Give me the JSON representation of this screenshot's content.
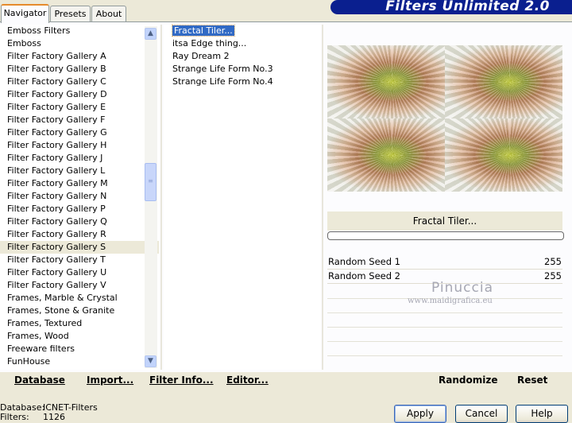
{
  "tabs": [
    "Navigator",
    "Presets",
    "About"
  ],
  "banner_title": "Filters Unlimited 2.0",
  "categories": [
    "Emboss Filters",
    "Emboss",
    "Filter Factory Gallery A",
    "Filter Factory Gallery B",
    "Filter Factory Gallery C",
    "Filter Factory Gallery D",
    "Filter Factory Gallery E",
    "Filter Factory Gallery F",
    "Filter Factory Gallery G",
    "Filter Factory Gallery H",
    "Filter Factory Gallery J",
    "Filter Factory Gallery L",
    "Filter Factory Gallery M",
    "Filter Factory Gallery N",
    "Filter Factory Gallery P",
    "Filter Factory Gallery Q",
    "Filter Factory Gallery R",
    "Filter Factory Gallery S",
    "Filter Factory Gallery T",
    "Filter Factory Gallery U",
    "Filter Factory Gallery V",
    "Frames, Marble & Crystal",
    "Frames, Stone & Granite",
    "Frames, Textured",
    "Frames, Wood",
    "Freeware filters",
    "FunHouse"
  ],
  "selected_category_index": 17,
  "filters": [
    "Fractal Tiler...",
    "itsa Edge thing...",
    "Ray Dream 2",
    "Strange Life Form No.3",
    "Strange Life Form No.4"
  ],
  "selected_filter_index": 0,
  "preview": {
    "filter_name": "Fractal Tiler..."
  },
  "params": [
    {
      "name": "Random Seed 1",
      "value": "255"
    },
    {
      "name": "Random Seed 2",
      "value": "255"
    }
  ],
  "watermark": {
    "name": "Pinuccia",
    "site": "www.maidigrafica.eu"
  },
  "toolbar": {
    "database": "Database",
    "import": "Import...",
    "filter_info": "Filter Info...",
    "editor": "Editor...",
    "randomize": "Randomize",
    "reset": "Reset"
  },
  "status": {
    "database_label": "Database:",
    "database_value": "ICNET-Filters",
    "filters_label": "Filters:",
    "filters_value": "1126"
  },
  "buttons": {
    "apply": "Apply",
    "cancel": "Cancel",
    "help": "Help"
  },
  "colors": {
    "banner": "#0a1f8f",
    "selection": "#316ac5",
    "dialog": "#ece9d8"
  }
}
